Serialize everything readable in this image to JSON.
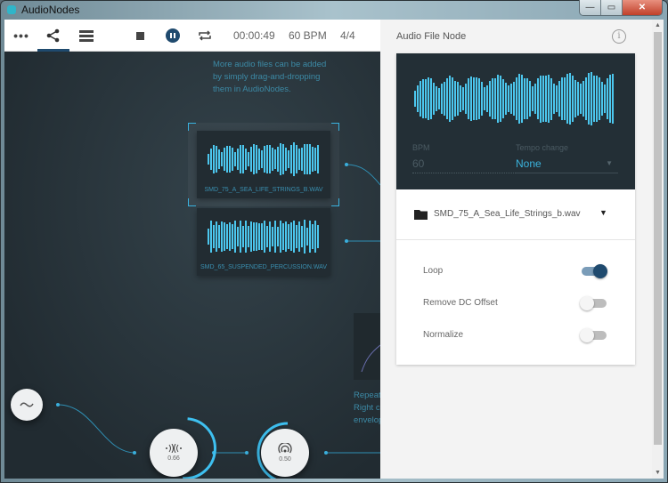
{
  "window": {
    "title": "AudioNodes",
    "minimize": "—",
    "maximize": "▭",
    "close": "✕"
  },
  "toolbar": {
    "more_icon": "more-horizontal-icon",
    "time": "00:00:49",
    "bpm": "60 BPM",
    "signature": "4/4",
    "accent": "#1f4a6e"
  },
  "canvas": {
    "hint_top": [
      "More audio files can be added",
      "by simply drag-and-dropping",
      "them in AudioNodes."
    ],
    "hint_bottom": [
      "Repeatin",
      "Right cli",
      "envelop"
    ],
    "cards": [
      {
        "label": "SMD_75_A_SEA_LIFE_STRINGS_B.WAV",
        "selected": true
      },
      {
        "label": "SMD_65_SUSPENDED_PERCUSSION.WAV",
        "selected": false
      }
    ],
    "nodes": [
      {
        "icon": "oscillator-wave-icon"
      },
      {
        "icon": "stereo-panner-icon",
        "value": "0.66"
      },
      {
        "icon": "broadcast-icon",
        "value": "0.50"
      }
    ],
    "wire_color": "#3aaedb"
  },
  "panel": {
    "title": "Audio File Node",
    "info": "i",
    "bpm_label": "BPM",
    "bpm_value": "60",
    "tempo_label": "Tempo change",
    "tempo_value": "None",
    "file": "SMD_75_A_Sea_Life_Strings_b.wav",
    "options": [
      {
        "label": "Loop",
        "on": true
      },
      {
        "label": "Remove DC Offset",
        "on": false
      },
      {
        "label": "Normalize",
        "on": false
      }
    ]
  }
}
